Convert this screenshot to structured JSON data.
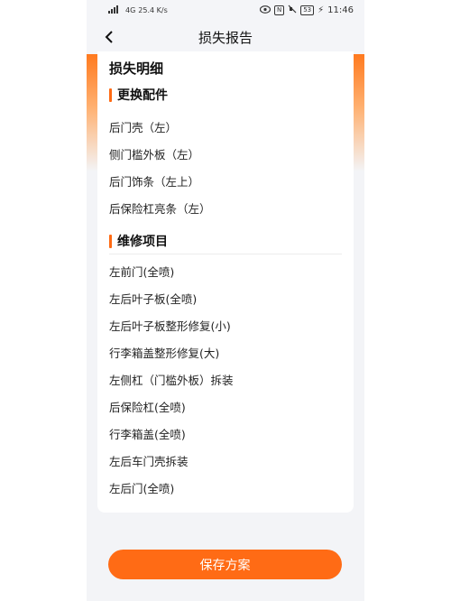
{
  "status_bar": {
    "carrier_signal": "4G",
    "speed": "25.4 K/s",
    "nfc": "N",
    "battery": "53",
    "time": "11:46"
  },
  "nav": {
    "title": "损失报告"
  },
  "loss_details": {
    "title": "损失明细",
    "parts_section": {
      "label": "更换配件",
      "items": [
        "后门壳（左）",
        "侧门槛外板（左）",
        "后门饰条（左上）",
        "后保险杠亮条（左）"
      ]
    },
    "repair_section": {
      "label": "维修项目",
      "items": [
        "左前门(全喷)",
        "左后叶子板(全喷)",
        "左后叶子板整形修复(小)",
        "行李箱盖整形修复(大)",
        "左侧杠（门槛外板）拆装",
        "后保险杠(全喷)",
        "行李箱盖(全喷)",
        "左后车门壳拆装",
        "左后门(全喷)"
      ]
    }
  },
  "footer": {
    "save_label": "保存方案"
  },
  "colors": {
    "accent": "#ff6b15",
    "background": "#f3f4f7"
  }
}
